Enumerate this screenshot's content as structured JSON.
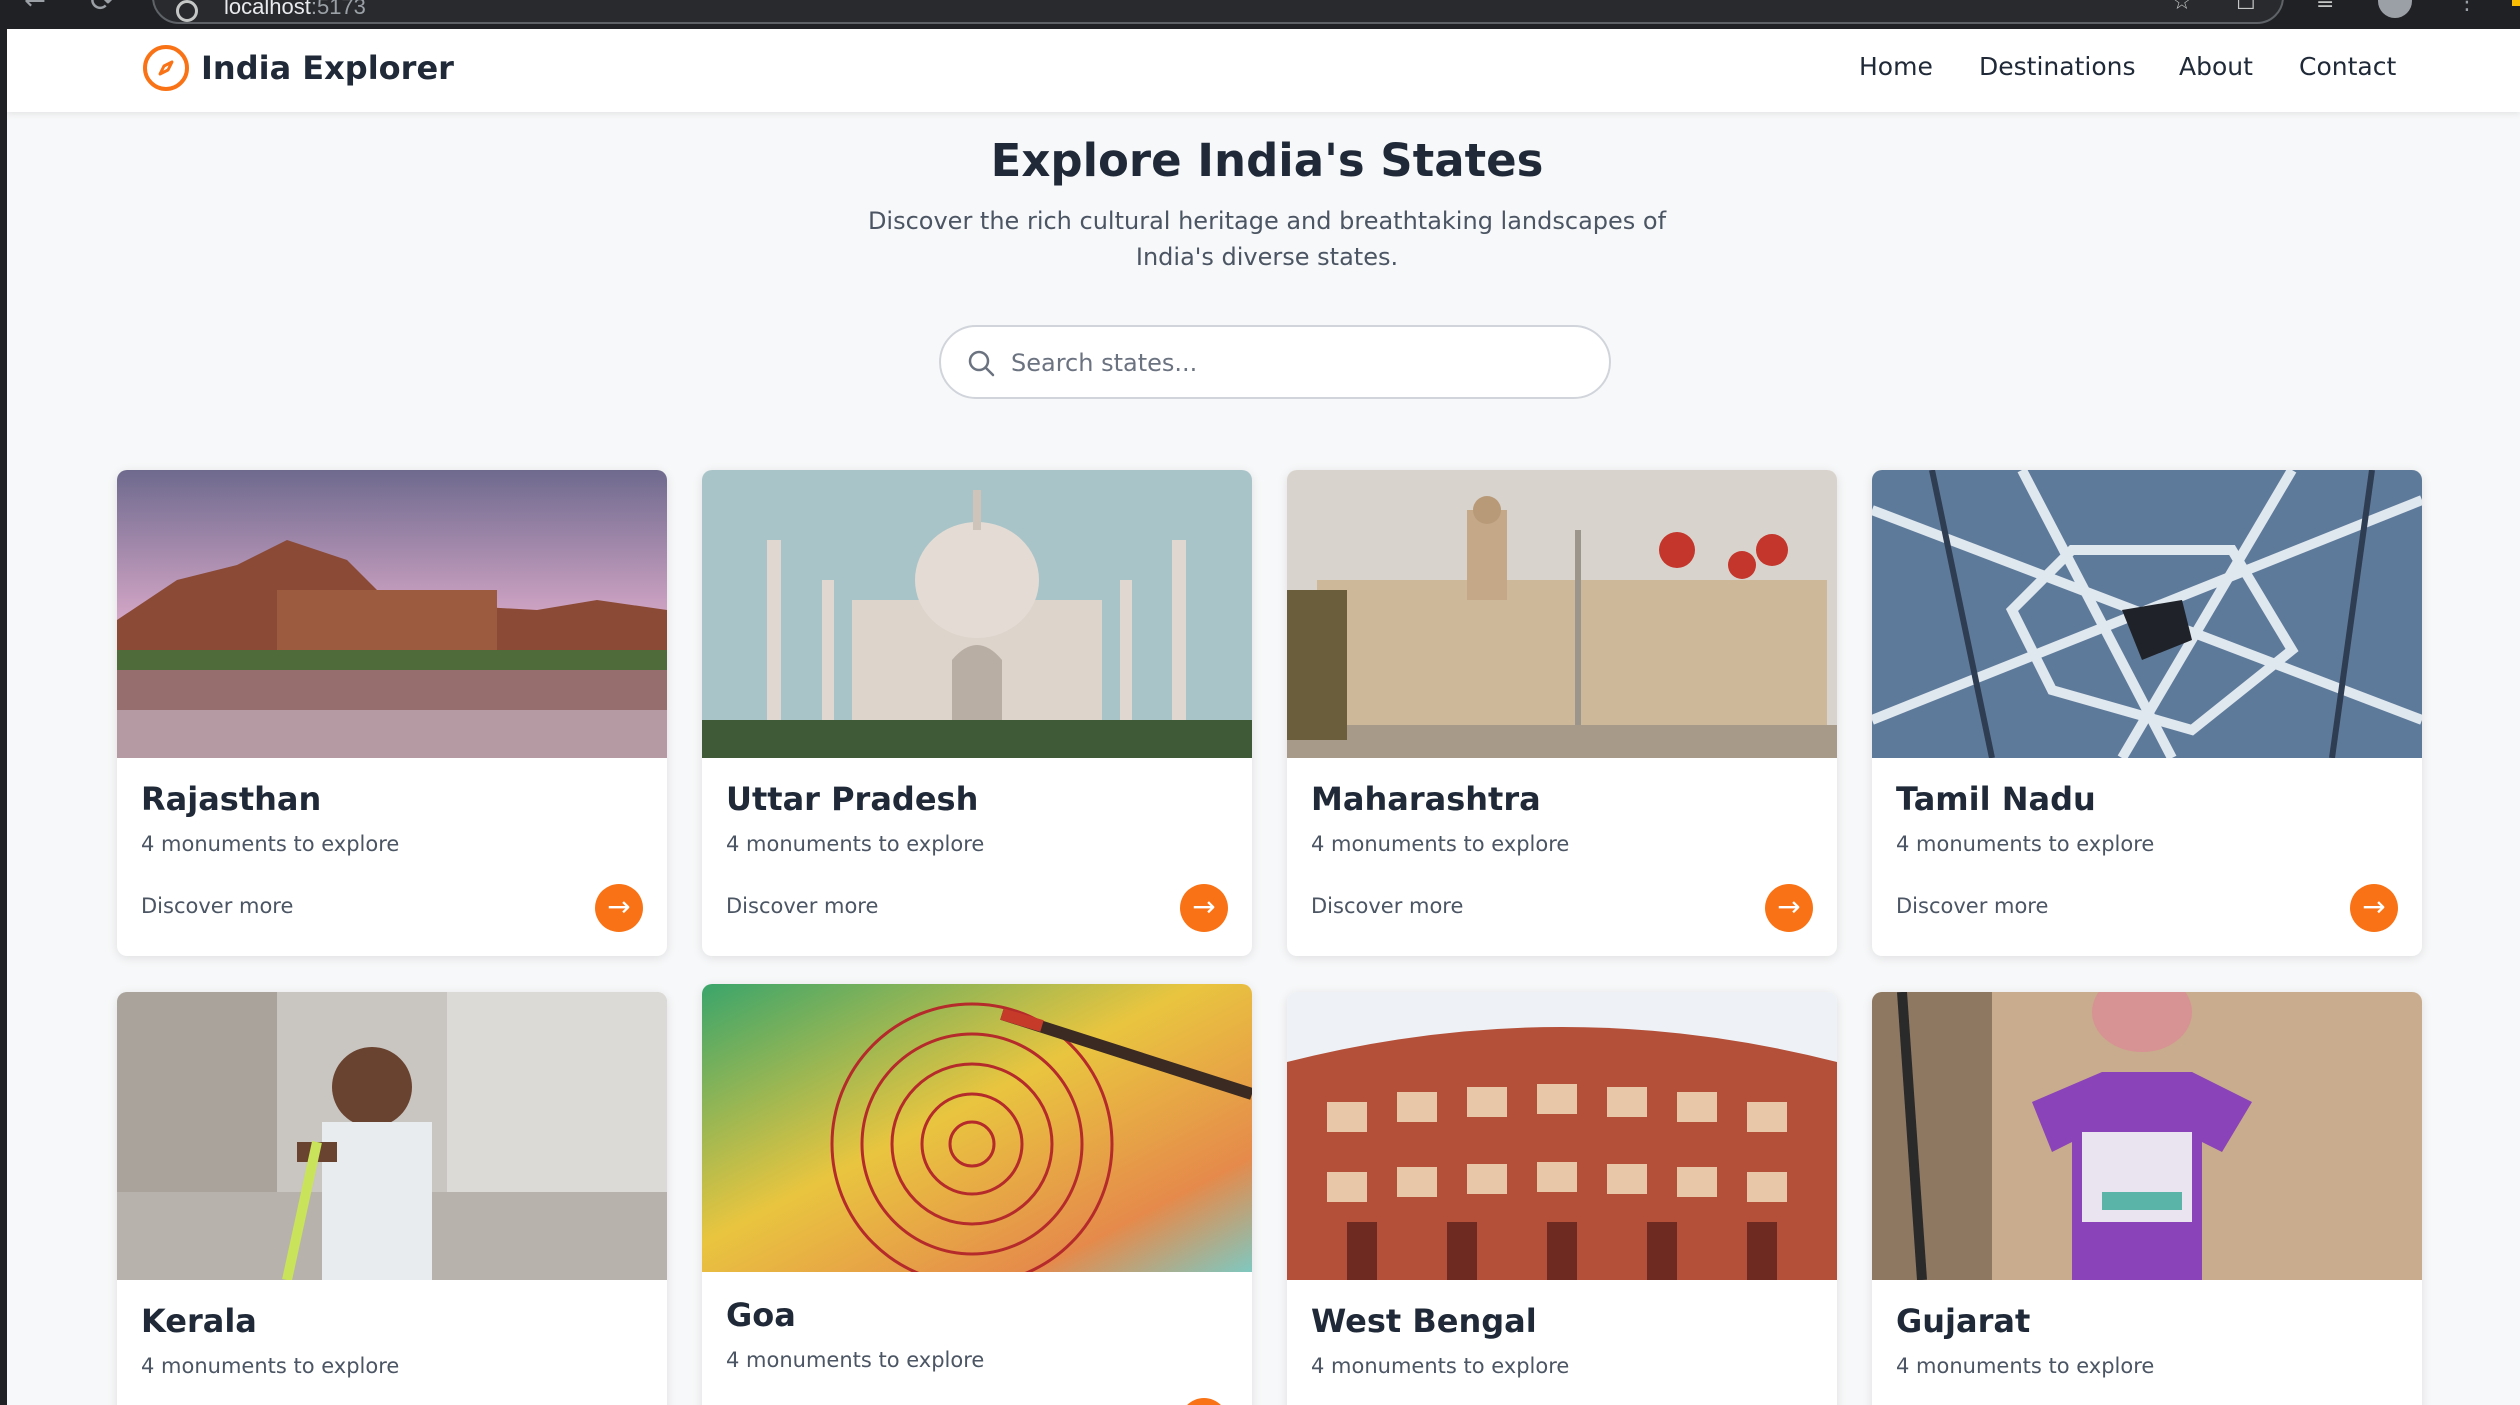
{
  "browser": {
    "url_host": "localhost",
    "url_port": ":5173"
  },
  "brand": {
    "name": "India Explorer"
  },
  "nav": {
    "home": "Home",
    "destinations": "Destinations",
    "about": "About",
    "contact": "Contact"
  },
  "hero": {
    "title": "Explore India's States",
    "subtitle": "Discover the rich cultural heritage and breathtaking landscapes of India's diverse states."
  },
  "search": {
    "placeholder": "Search states..."
  },
  "cards": [
    {
      "title": "Rajasthan",
      "subtitle": "4 monuments to explore",
      "link": "Discover more",
      "arrow": "→"
    },
    {
      "title": "Uttar Pradesh",
      "subtitle": "4 monuments to explore",
      "link": "Discover more",
      "arrow": "→"
    },
    {
      "title": "Maharashtra",
      "subtitle": "4 monuments to explore",
      "link": "Discover more",
      "arrow": "→"
    },
    {
      "title": "Tamil Nadu",
      "subtitle": "4 monuments to explore",
      "link": "Discover more",
      "arrow": "→"
    },
    {
      "title": "Kerala",
      "subtitle": "4 monuments to explore"
    },
    {
      "title": "Goa",
      "subtitle": "4 monuments to explore"
    },
    {
      "title": "West Bengal",
      "subtitle": "4 monuments to explore"
    },
    {
      "title": "Gujarat",
      "subtitle": "4 monuments to explore"
    }
  ],
  "colors": {
    "accent": "#f97316",
    "heading": "#1f2937",
    "body_text": "#4b5563",
    "page_background": "#f7f8f9"
  },
  "icons": {
    "brand": "compass-icon",
    "search": "search-icon",
    "card_action": "arrow-right-icon"
  }
}
